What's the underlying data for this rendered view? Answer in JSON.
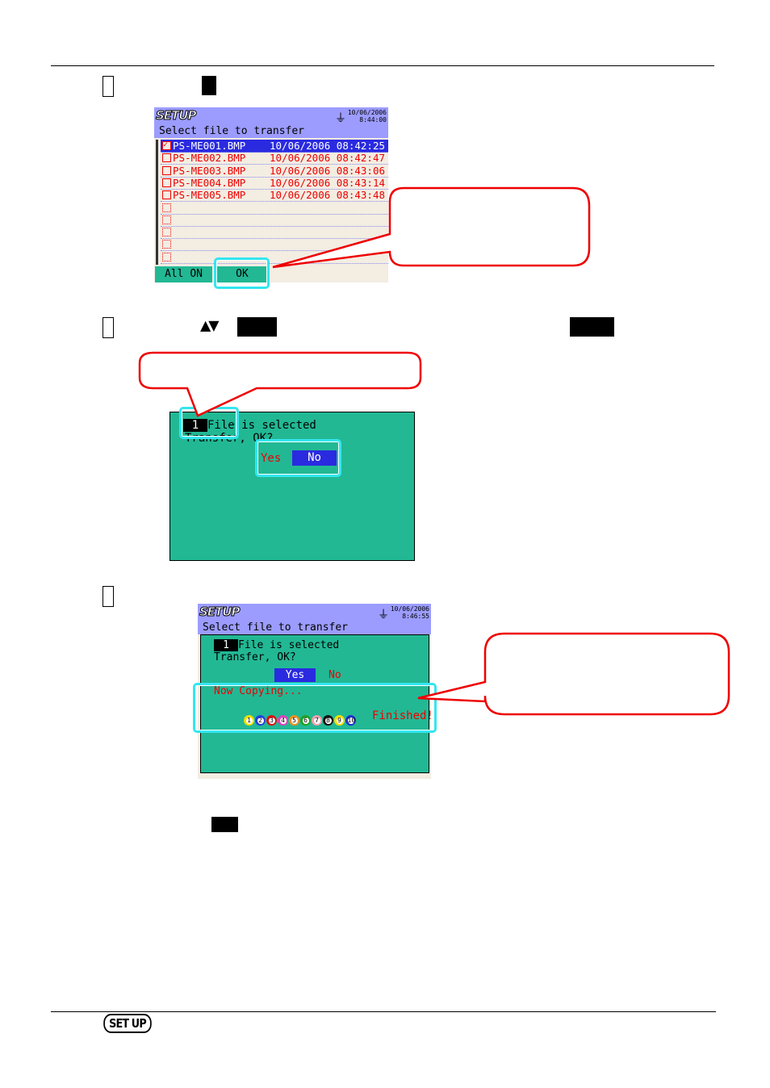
{
  "screen1": {
    "logo": "SETUP",
    "date": "10/06/2006",
    "time": "8:44:00",
    "subtitle": "Select file to transfer",
    "files": [
      {
        "name": "PS-ME001.BMP",
        "date": "10/06/2006",
        "time": "08:42:25",
        "checked": true,
        "selected": true
      },
      {
        "name": "PS-ME002.BMP",
        "date": "10/06/2006",
        "time": "08:42:47",
        "checked": false,
        "selected": false
      },
      {
        "name": "PS-ME003.BMP",
        "date": "10/06/2006",
        "time": "08:43:06",
        "checked": false,
        "selected": false
      },
      {
        "name": "PS-ME004.BMP",
        "date": "10/06/2006",
        "time": "08:43:14",
        "checked": false,
        "selected": false
      },
      {
        "name": "PS-ME005.BMP",
        "date": "10/06/2006",
        "time": "08:43:48",
        "checked": false,
        "selected": false
      }
    ],
    "all_on_label": "All ON",
    "ok_label": "OK"
  },
  "screen2": {
    "count": "1",
    "selected_text": "File is selected",
    "confirm_text": "Transfer, OK?",
    "yes_label": "Yes",
    "no_label": "No"
  },
  "screen3": {
    "logo": "SETUP",
    "date": "10/06/2006",
    "time": "8:46:55",
    "subtitle": "Select file to transfer",
    "count": "1",
    "selected_text": "File is selected",
    "confirm_text": "Transfer, OK?",
    "yes_label": "Yes",
    "no_label": "No",
    "copying_text": "Now Copying...",
    "progress_balls": [
      "1",
      "2",
      "3",
      "4",
      "5",
      "6",
      "7",
      "8",
      "9",
      "10"
    ],
    "finished_text": "Finished!"
  },
  "footer": {
    "setup_key_label": "SET UP"
  },
  "colors": {
    "teal": "#22b894",
    "lavender": "#9c9cff",
    "highlight": "#2a2ae0",
    "red": "#e00000",
    "cyan": "#33e6f0"
  },
  "icons": {
    "step1_arrows": "up-down-triangles",
    "plug": "power-plug-icon"
  }
}
